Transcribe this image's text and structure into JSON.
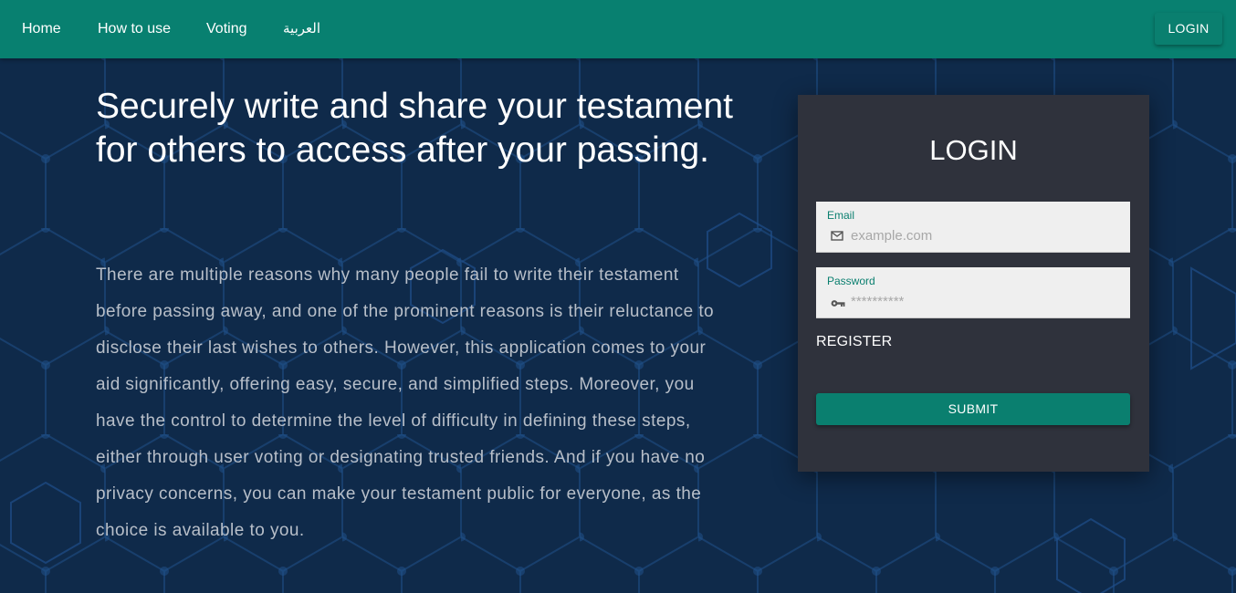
{
  "nav": {
    "links": [
      "Home",
      "How to use",
      "Voting",
      "العربية"
    ],
    "login_label": "LOGIN"
  },
  "hero": {
    "title": "Securely write and share your testament for others to access after your passing.",
    "description": "There are multiple reasons why many people fail to write their testament before passing away, and one of the prominent reasons is their reluctance to disclose their last wishes to others. However, this application comes to your aid significantly, offering easy, secure, and simplified steps. Moreover, you have the control to determine the level of difficulty in defining these steps, either through user voting or designating trusted friends. And if you have no privacy concerns, you can make your testament public for everyone, as the choice is available to you."
  },
  "login_form": {
    "title": "LOGIN",
    "email_label": "Email",
    "email_placeholder": "example.com",
    "email_icon": "mail-icon",
    "password_label": "Password",
    "password_placeholder": "**********",
    "password_icon": "key-icon",
    "register_label": "REGISTER",
    "submit_label": "SUBMIT"
  },
  "colors": {
    "navbar": "#088070",
    "accent": "#0a7f6f",
    "background": "#0f2a4a",
    "card": "#2f323c",
    "hex_pattern": "#1f4f8a"
  }
}
